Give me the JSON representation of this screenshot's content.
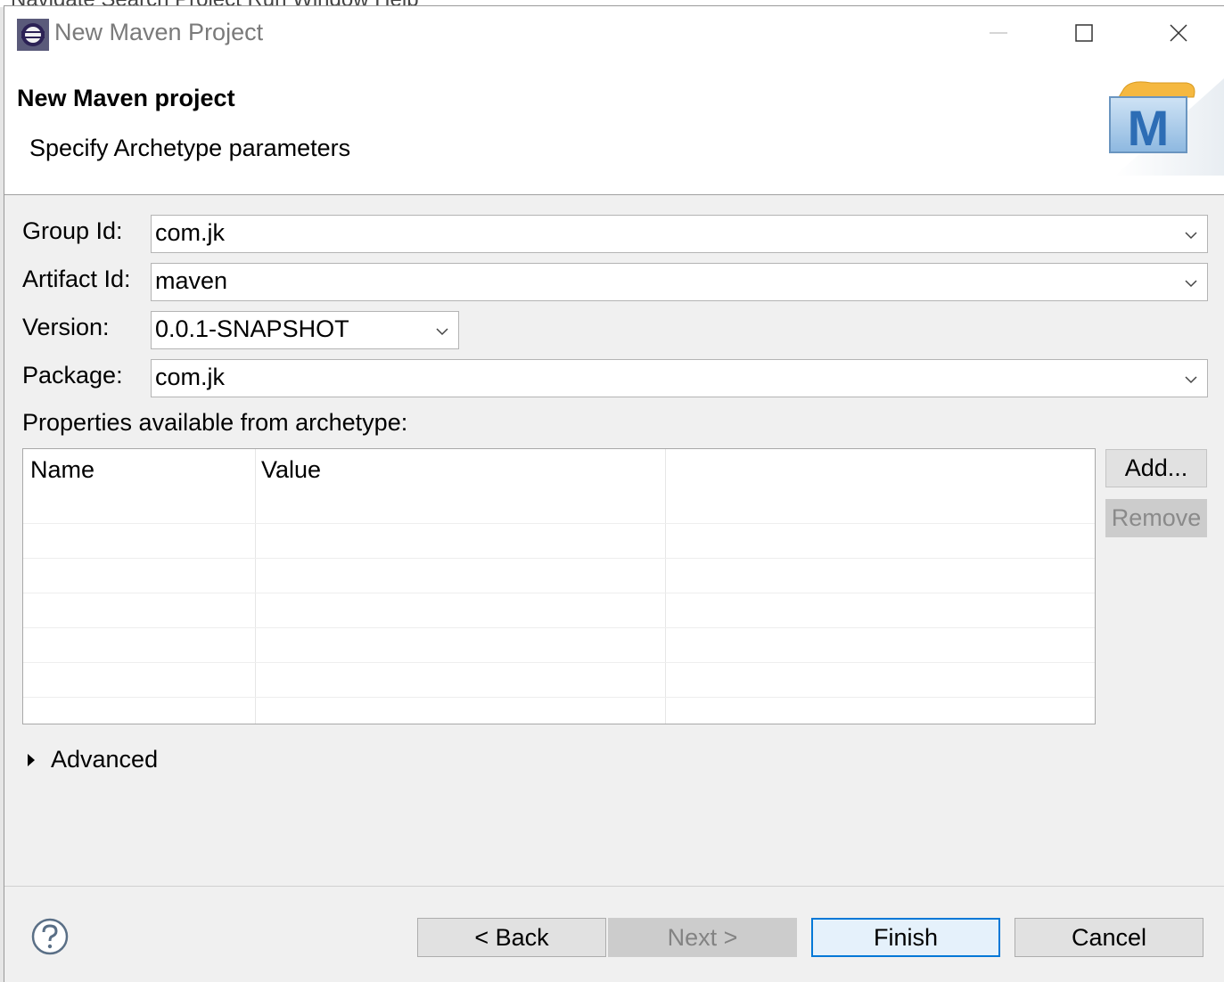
{
  "ide": {
    "menu_text": "Navigate  Search  Project  Run  Window  Help"
  },
  "window": {
    "title": "New Maven Project"
  },
  "banner": {
    "title": "New Maven project",
    "subtitle": "Specify Archetype parameters",
    "logo_letter": "M"
  },
  "form": {
    "group_id": {
      "label": "Group Id:",
      "value": "com.jk"
    },
    "artifact_id": {
      "label": "Artifact Id:",
      "value": "maven"
    },
    "version": {
      "label": "Version:",
      "value": "0.0.1-SNAPSHOT"
    },
    "package": {
      "label": "Package:",
      "value": "com.jk"
    }
  },
  "properties": {
    "label": "Properties available from archetype:",
    "columns": [
      "Name",
      "Value"
    ],
    "rows": [],
    "add_label": "Add...",
    "remove_label": "Remove"
  },
  "advanced": {
    "label": "Advanced",
    "expanded": false
  },
  "footer": {
    "back_label": "< Back",
    "next_label": "Next >",
    "finish_label": "Finish",
    "cancel_label": "Cancel"
  },
  "colors": {
    "accent": "#0078d7",
    "disabled_bg": "#cccccc",
    "logo_blue": "#2d6db5"
  },
  "icons": [
    "eclipse-app-icon",
    "minimize-icon",
    "maximize-icon",
    "close-icon",
    "maven-logo-icon",
    "chevron-down-icon",
    "expand-arrow-icon",
    "help-icon"
  ]
}
